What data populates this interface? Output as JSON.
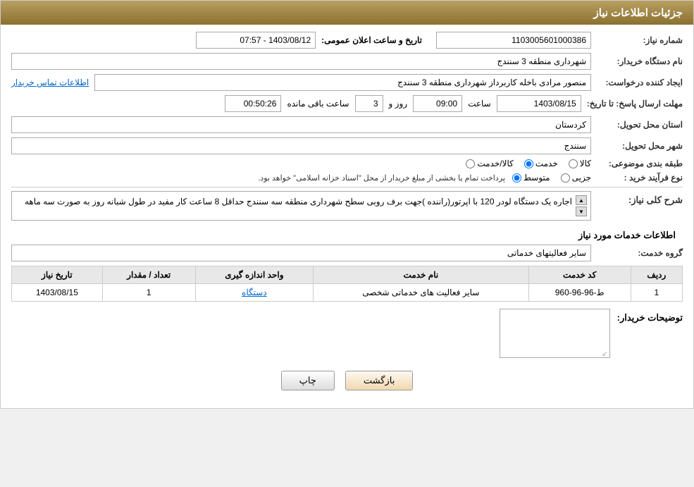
{
  "header": {
    "title": "جزئیات اطلاعات نیاز"
  },
  "fields": {
    "need_number_label": "شماره نیاز:",
    "need_number_value": "1103005601000386",
    "announce_label": "تاریخ و ساعت اعلان عمومی:",
    "announce_value": "1403/08/12 - 07:57",
    "buyer_name_label": "نام دستگاه خریدار:",
    "buyer_name_value": "شهرداری منطقه 3 سنندج",
    "creator_label": "ایجاد کننده درخواست:",
    "creator_value": "منصور مرادی باخله کاربرداز شهرداری منطقه 3 سنندج",
    "contact_link": "اطلاعات تماس خریدار",
    "deadline_label": "مهلت ارسال پاسخ: تا تاریخ:",
    "deadline_date": "1403/08/15",
    "deadline_time_label": "ساعت",
    "deadline_time": "09:00",
    "deadline_days_label": "روز و",
    "deadline_days": "3",
    "deadline_remaining_label": "ساعت باقی مانده",
    "deadline_remaining": "00:50:26",
    "province_label": "استان محل تحویل:",
    "province_value": "کردستان",
    "city_label": "شهر محل تحویل:",
    "city_value": "سنندج",
    "category_label": "طبقه بندی موضوعی:",
    "radio_options": [
      "کالا",
      "خدمت",
      "کالا/خدمت"
    ],
    "radio_selected": "خدمت",
    "purchase_type_label": "نوع فرآیند خرید :",
    "purchase_options": [
      "جزیی",
      "متوسط"
    ],
    "purchase_note": "پرداخت تمام یا بخشی از مبلغ خریدار از محل \"اسناد خزانه اسلامی\" خواهد بود.",
    "need_description_label": "شرح کلی نیاز:",
    "need_description": "اجاره یک دستگاه لودر 120 با اپرتور(راننده )جهت برف روبی سطح شهرداری منطقه سه سنندج حداقل 8 ساعت کار مفید در طول شبانه روز به صورت سه ماهه",
    "services_section_label": "اطلاعات خدمات مورد نیاز",
    "service_group_label": "گروه خدمت:",
    "service_group_value": "سایر فعالیتهای خدماتی",
    "table": {
      "headers": [
        "ردیف",
        "کد خدمت",
        "نام خدمت",
        "واحد اندازه گیری",
        "تعداد / مقدار",
        "تاریخ نیاز"
      ],
      "rows": [
        {
          "row": "1",
          "code": "ط-96-96-960",
          "name": "سایر فعالیت های خدماتی شخصی",
          "unit": "دستگاه",
          "quantity": "1",
          "date": "1403/08/15"
        }
      ]
    },
    "buyer_notes_label": "توضیحات خریدار:",
    "buyer_notes_value": ""
  },
  "buttons": {
    "print": "چاپ",
    "back": "بازگشت"
  }
}
